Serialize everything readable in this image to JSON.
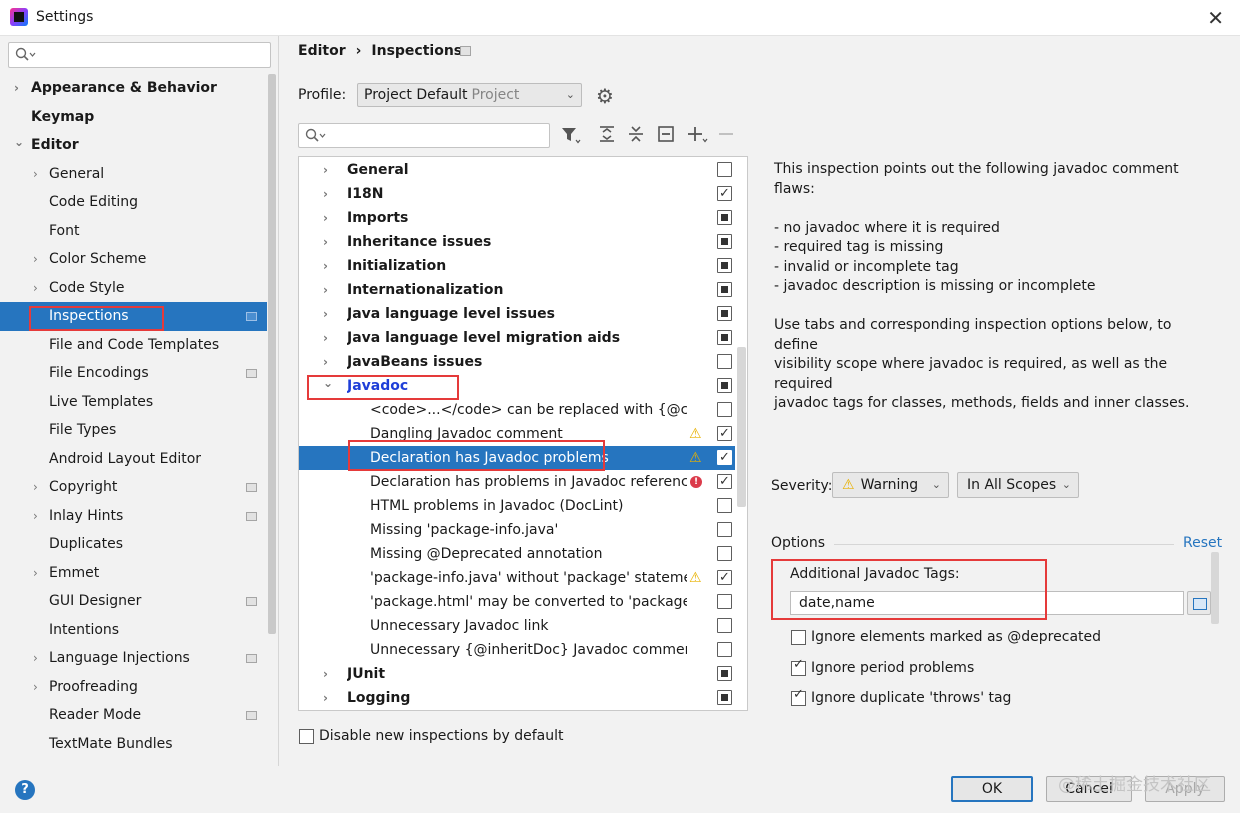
{
  "window": {
    "title": "Settings",
    "close_glyph": "✕"
  },
  "sidebar": {
    "search_placeholder": "",
    "items": [
      {
        "label": "Appearance & Behavior",
        "chevron": "›"
      },
      {
        "label": "Keymap"
      },
      {
        "label": "Editor",
        "chevron": "⌄"
      },
      {
        "label": "General",
        "chevron": "›"
      },
      {
        "label": "Code Editing"
      },
      {
        "label": "Font"
      },
      {
        "label": "Color Scheme",
        "chevron": "›"
      },
      {
        "label": "Code Style",
        "chevron": "›"
      },
      {
        "label": "Inspections"
      },
      {
        "label": "File and Code Templates"
      },
      {
        "label": "File Encodings"
      },
      {
        "label": "Live Templates"
      },
      {
        "label": "File Types"
      },
      {
        "label": "Android Layout Editor"
      },
      {
        "label": "Copyright",
        "chevron": "›"
      },
      {
        "label": "Inlay Hints",
        "chevron": "›"
      },
      {
        "label": "Duplicates"
      },
      {
        "label": "Emmet",
        "chevron": "›"
      },
      {
        "label": "GUI Designer"
      },
      {
        "label": "Intentions"
      },
      {
        "label": "Language Injections",
        "chevron": "›"
      },
      {
        "label": "Proofreading",
        "chevron": "›"
      },
      {
        "label": "Reader Mode"
      },
      {
        "label": "TextMate Bundles"
      }
    ],
    "help_label": "?"
  },
  "breadcrumb": {
    "root": "Editor",
    "sep": "›",
    "current": "Inspections"
  },
  "profile": {
    "label": "Profile:",
    "value": "Project Default",
    "scope": "Project",
    "arrow": "⌄",
    "gear_glyph": "⚙"
  },
  "tree": {
    "search_placeholder": "",
    "rows": [
      {
        "label": "General",
        "chevron": "›"
      },
      {
        "label": "I18N",
        "chevron": "›"
      },
      {
        "label": "Imports",
        "chevron": "›"
      },
      {
        "label": "Inheritance issues",
        "chevron": "›"
      },
      {
        "label": "Initialization",
        "chevron": "›"
      },
      {
        "label": "Internationalization",
        "chevron": "›"
      },
      {
        "label": "Java language level issues",
        "chevron": "›"
      },
      {
        "label": "Java language level migration aids",
        "chevron": "›"
      },
      {
        "label": "JavaBeans issues",
        "chevron": "›"
      },
      {
        "label": "Javadoc",
        "chevron": "⌄"
      },
      {
        "label": "<code>...</code> can be replaced with {@code ...}"
      },
      {
        "label": "Dangling Javadoc comment",
        "warn": "⚠"
      },
      {
        "label": "Declaration has Javadoc problems",
        "warn": "⚠"
      },
      {
        "label": "Declaration has problems in Javadoc references",
        "err": "!"
      },
      {
        "label": "HTML problems in Javadoc (DocLint)"
      },
      {
        "label": "Missing 'package-info.java'"
      },
      {
        "label": "Missing @Deprecated annotation"
      },
      {
        "label": "'package-info.java' without 'package' statement",
        "warn": "⚠"
      },
      {
        "label": "'package.html' may be converted to 'package-info.java'"
      },
      {
        "label": "Unnecessary Javadoc link"
      },
      {
        "label": "Unnecessary {@inheritDoc} Javadoc comment"
      },
      {
        "label": "JUnit",
        "chevron": "›"
      },
      {
        "label": "Logging",
        "chevron": "›"
      }
    ],
    "disable_new_label": "Disable new inspections by default"
  },
  "description": {
    "intro": "This inspection points out the following javadoc comment flaws:",
    "bullets": [
      "- no javadoc where it is required",
      "- required tag is missing",
      "- invalid or incomplete tag",
      "- javadoc description is missing or incomplete"
    ],
    "outro_lines": [
      "Use tabs and corresponding inspection options below, to define",
      "visibility scope where javadoc is required, as well as the required",
      "javadoc tags for classes, methods, fields and inner classes."
    ]
  },
  "severity": {
    "label": "Severity:",
    "value": "Warning",
    "warn": "⚠",
    "scope": "In All Scopes",
    "arrow": "⌄"
  },
  "options": {
    "title": "Options",
    "reset": "Reset",
    "tags_label": "Additional Javadoc Tags:",
    "tags_value": "date,name",
    "checks": [
      {
        "label": "Ignore elements marked as @deprecated",
        "checked": false
      },
      {
        "label": "Ignore period problems",
        "checked": true
      },
      {
        "label": "Ignore duplicate 'throws' tag",
        "checked": true
      }
    ]
  },
  "buttons": {
    "ok": "OK",
    "cancel": "Cancel",
    "apply": "Apply"
  },
  "watermark": "@稀土掘金技术社区"
}
